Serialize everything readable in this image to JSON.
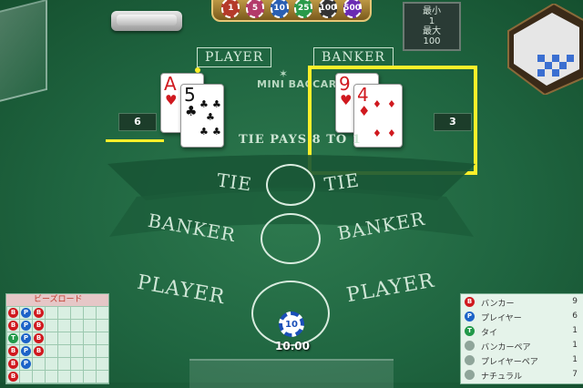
{
  "table": {
    "player_label": "PLAYER",
    "banker_label": "BANKER",
    "title": "MINI BACCARAT",
    "tie_pays": "TIE PAYS 8 TO 1",
    "tie_left": "TIE",
    "tie_right": "TIE",
    "banker_left": "BANKER",
    "banker_right": "BANKER",
    "player_left": "PLAYER",
    "player_right": "PLAYER"
  },
  "info_panel": {
    "line1": "最小",
    "line2": "1",
    "line3": "最大",
    "line4": "100"
  },
  "chip_tray": [
    "1",
    "5",
    "10",
    "25",
    "100",
    "500"
  ],
  "player_hand": {
    "score": "6",
    "cards": [
      {
        "rank": "A",
        "suit": "♥"
      },
      {
        "rank": "5",
        "suit": "♣"
      }
    ]
  },
  "banker_hand": {
    "score": "3",
    "cards": [
      {
        "rank": "9",
        "suit": "♥"
      },
      {
        "rank": "4",
        "suit": "♦"
      }
    ]
  },
  "bet": {
    "chip_value": "10",
    "amount": "10.00"
  },
  "bead_road": {
    "title": "ビーズロード",
    "beads": [
      [
        "B",
        "P",
        "B"
      ],
      [
        "B",
        "P",
        "B"
      ],
      [
        "T",
        "P",
        "B"
      ],
      [
        "B",
        "P",
        "B"
      ],
      [
        "B",
        "P",
        ""
      ],
      [
        "B",
        "",
        ""
      ]
    ]
  },
  "stats": [
    {
      "icon": "B",
      "label": "バンカー",
      "value": "9"
    },
    {
      "icon": "P",
      "label": "プレイヤー",
      "value": "6"
    },
    {
      "icon": "T",
      "label": "タイ",
      "value": "1"
    },
    {
      "icon": "",
      "label": "バンカーペア",
      "value": "1"
    },
    {
      "icon": "",
      "label": "プレイヤーペア",
      "value": "1"
    },
    {
      "icon": "",
      "label": "ナチュラル",
      "value": "7"
    }
  ],
  "colors": {
    "banker": "#d0191f",
    "player": "#1d63c8",
    "tie": "#22994a",
    "highlight": "#ffef2a"
  }
}
